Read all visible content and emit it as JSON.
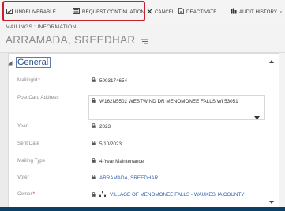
{
  "toolbar": {
    "undeliverable_label": "UNDELIVERABLE",
    "request_continuation_label": "REQUEST CONTINUATION",
    "cancel_label": "CANCEL",
    "deactivate_label": "DEACTIVATE",
    "audit_history_label": "AUDIT HISTORY",
    "more_label": "‹"
  },
  "header": {
    "breadcrumb": "MAILINGS : INFORMATION",
    "record_title": "ARRAMADA, SREEDHAR"
  },
  "section": {
    "title": "General"
  },
  "fields": {
    "mailing_id": {
      "label": "MailingId",
      "value": "5003174654"
    },
    "post_card_address": {
      "label": "Post Card Address",
      "value": "W162N5502 WESTWIND DR MENOMONEE FALLS WI 53051"
    },
    "year": {
      "label": "Year",
      "value": "2023"
    },
    "sent_date": {
      "label": "Sent Date",
      "value": "5/10/2023"
    },
    "mailing_type": {
      "label": "Mailing Type",
      "value": "4-Year Maintenance"
    },
    "voter": {
      "label": "Voter",
      "value": "ARRAMADA, SREEDHAR"
    },
    "owner": {
      "label": "Owner",
      "value": "VILLAGE OF MENOMONEE FALLS - WAUKESHA COUNTY"
    }
  },
  "colors": {
    "highlight": "#c8202a",
    "link": "#2f5ea8",
    "frame": "#0b3f66"
  }
}
